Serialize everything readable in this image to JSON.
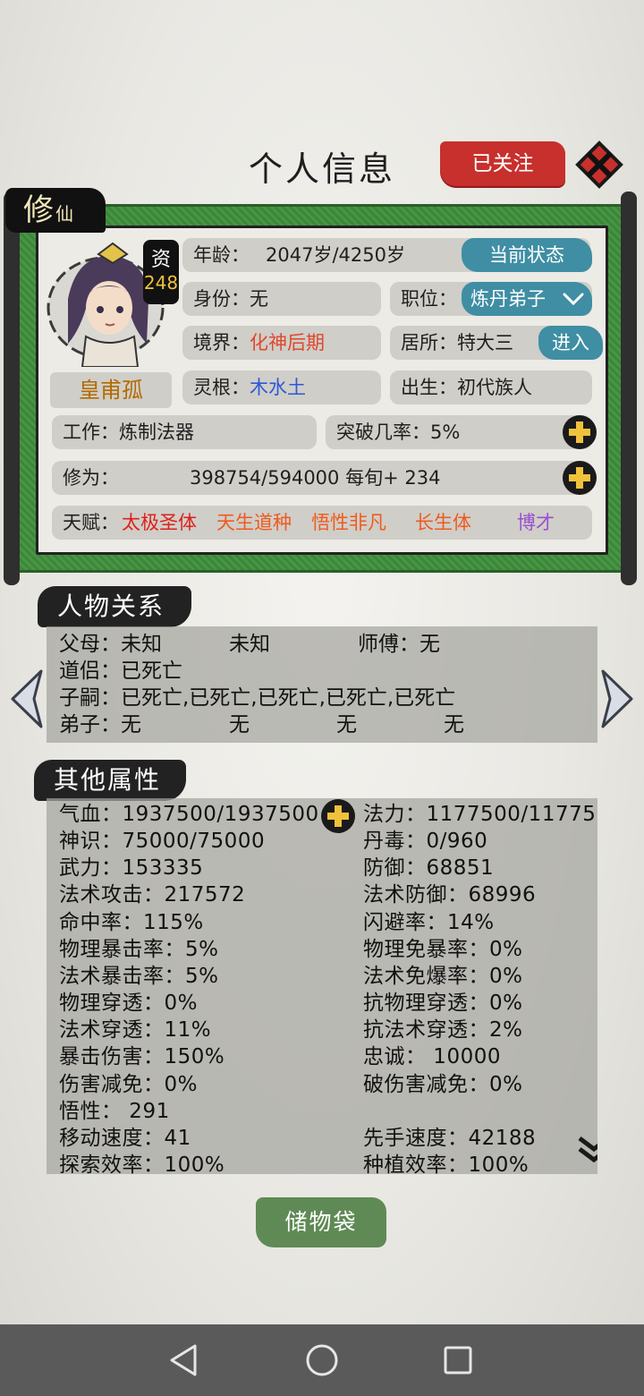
{
  "header": {
    "title": "个人信息",
    "follow_label": "已关注"
  },
  "profile": {
    "tag_big": "修",
    "tag_small": "仙",
    "aptitude_label": "资",
    "aptitude_value": "248",
    "name": "皇甫孤",
    "age_label": "年龄：",
    "age_value": "2047岁/4250岁",
    "status_button": "当前状态",
    "identity": "身份：无",
    "position_label": "职位：",
    "position_value": "炼丹弟子",
    "realm_label": "境界：",
    "realm_value": "化神后期",
    "residence": "居所：特大三",
    "enter_button": "进入",
    "root_label": "灵根：",
    "root_value": "木水土",
    "birth": "出生：初代族人",
    "work": "工作：炼制法器",
    "breakthrough": "突破几率：5%",
    "cultivation_label": "修为：",
    "cultivation_value": "398754/594000  每旬+ 234",
    "talent_label": "天赋：",
    "talents": [
      {
        "text": "太极圣体",
        "color": "#e0201c"
      },
      {
        "text": "天生道种",
        "color": "#f05a1e"
      },
      {
        "text": "悟性非凡",
        "color": "#f05a1e"
      },
      {
        "text": "长生体",
        "color": "#f05a1e"
      },
      {
        "text": "博才",
        "color": "#9a4fd0"
      }
    ]
  },
  "relations": {
    "title": "人物关系",
    "parents_label": "父母：未知",
    "parents_2": "未知",
    "master": "师傅：无",
    "partner": "道侣：已死亡",
    "children": "子嗣：已死亡,已死亡,已死亡,已死亡,已死亡",
    "disciples_label": "弟子：无",
    "disciples_2": "无",
    "disciples_3": "无",
    "disciples_4": "无"
  },
  "attributes": {
    "title": "其他属性",
    "left": [
      "气血：1937500/1937500",
      "神识：75000/75000",
      "武力：153335",
      "法术攻击：217572",
      "命中率：115%",
      "物理暴击率：5%",
      "法术暴击率：5%",
      "物理穿透：0%",
      "法术穿透：11%",
      "暴击伤害：150%",
      "伤害减免：0%",
      "悟性： 291",
      "移动速度：41",
      "探索效率：100%"
    ],
    "right": [
      "法力：1177500/11775",
      "丹毒：0/960",
      "防御：68851",
      "法术防御：68996",
      "闪避率：14%",
      "物理免暴率：0%",
      "法术免爆率：0%",
      "抗物理穿透：0%",
      "抗法术穿透：2%",
      "忠诚： 10000",
      "破伤害减免：0%",
      "",
      "先手速度：42188",
      "种植效率：100%"
    ]
  },
  "footer": {
    "storage_button": "储物袋"
  },
  "colors": {
    "follow": "#c7302c",
    "scroll_green": "#3f8f3c",
    "teal": "#3f8ea4",
    "realm": "#e0472c",
    "root": "#2d57d9",
    "store": "#5f8a55"
  }
}
